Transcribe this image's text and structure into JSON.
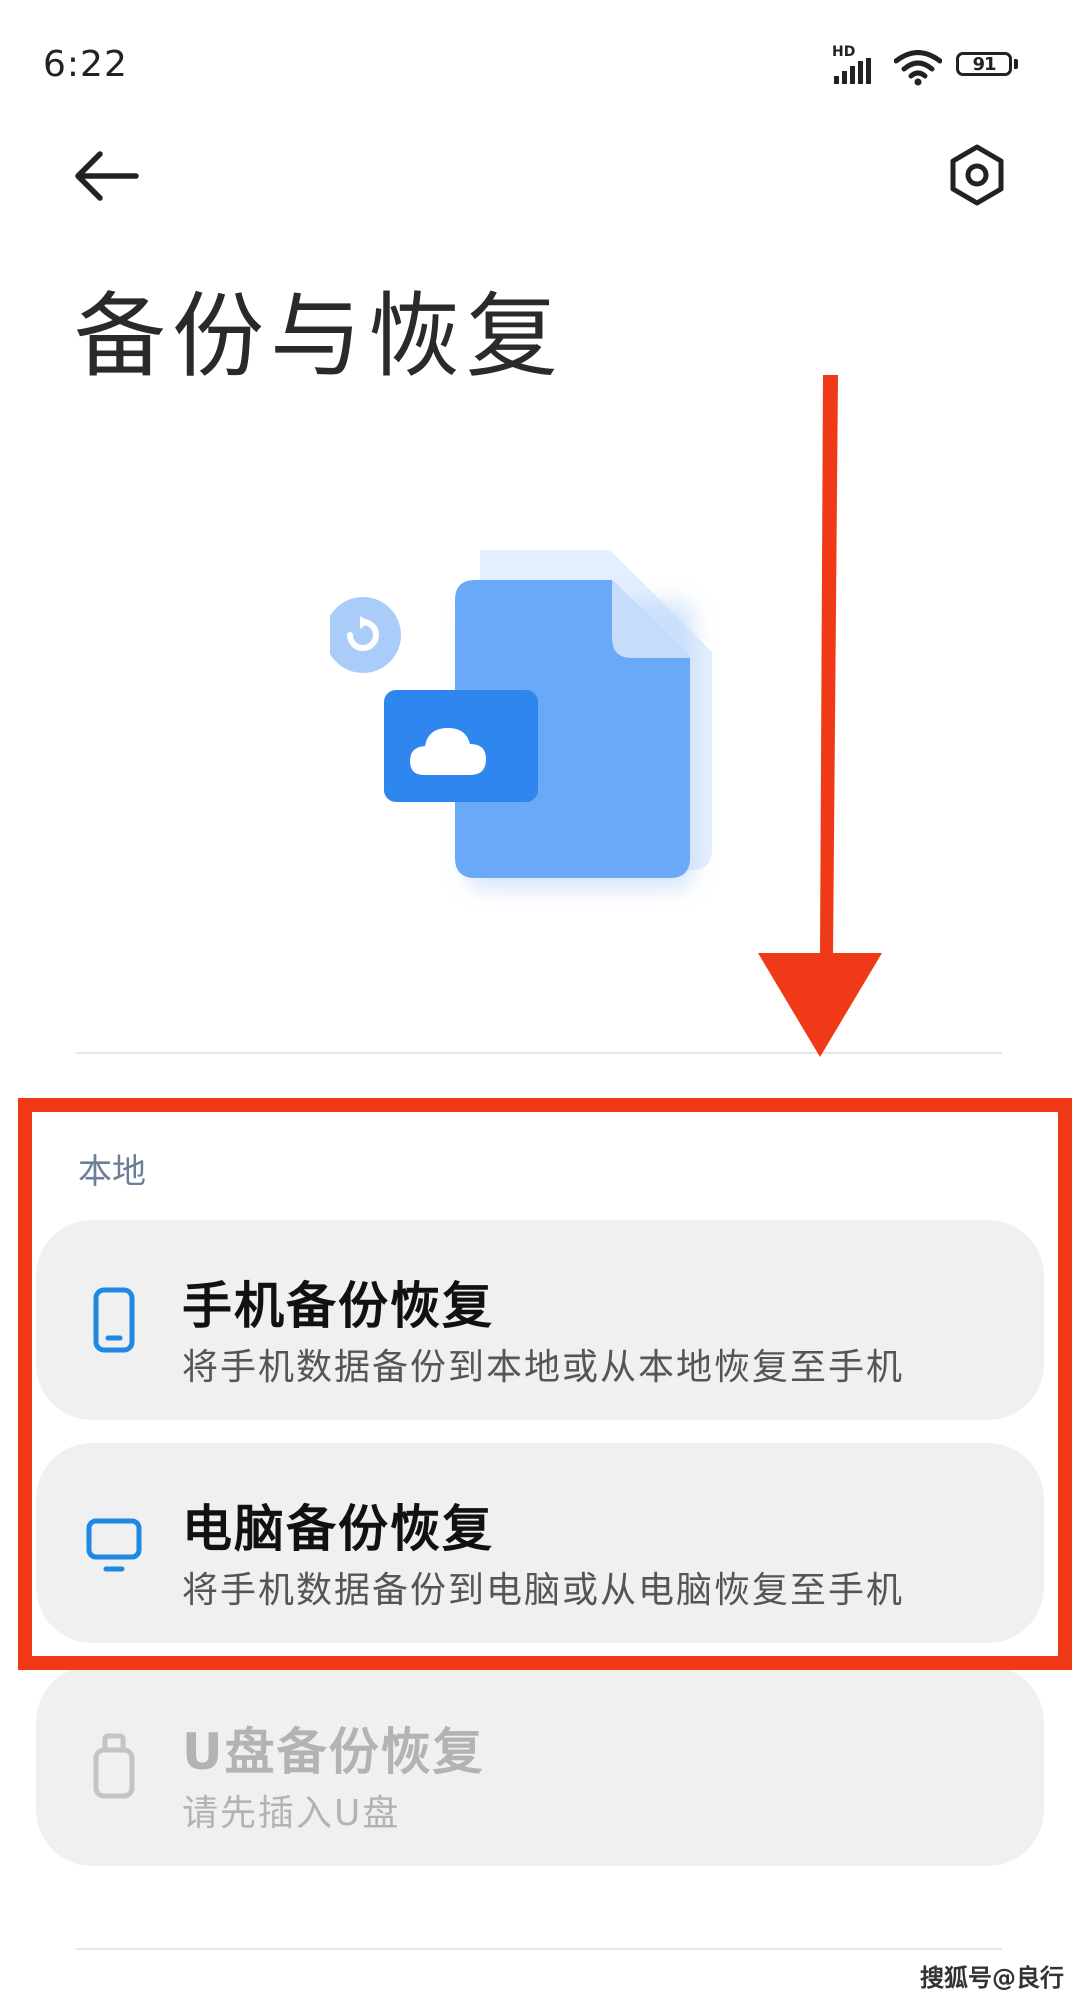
{
  "status_bar": {
    "time": "6:22",
    "network": "HD",
    "battery": "91"
  },
  "header": {
    "title": "备份与恢复",
    "back_icon": "arrow-left-icon",
    "settings_icon": "gear-icon"
  },
  "section": {
    "label": "本地"
  },
  "cards": [
    {
      "title": "手机备份恢复",
      "subtitle": "将手机数据备份到本地或从本地恢复至手机",
      "icon": "phone-icon",
      "enabled": true
    },
    {
      "title": "电脑备份恢复",
      "subtitle": "将手机数据备份到电脑或从电脑恢复至手机",
      "icon": "monitor-icon",
      "enabled": true
    },
    {
      "title": "U盘备份恢复",
      "subtitle": "请先插入U盘",
      "icon": "usb-drive-icon",
      "enabled": false
    }
  ],
  "colors": {
    "accent": "#1e88e5",
    "annotation": "#f03a17",
    "section_label": "#6b7e99",
    "card_bg": "#f0f0f0"
  },
  "watermark": "搜狐号@良行"
}
